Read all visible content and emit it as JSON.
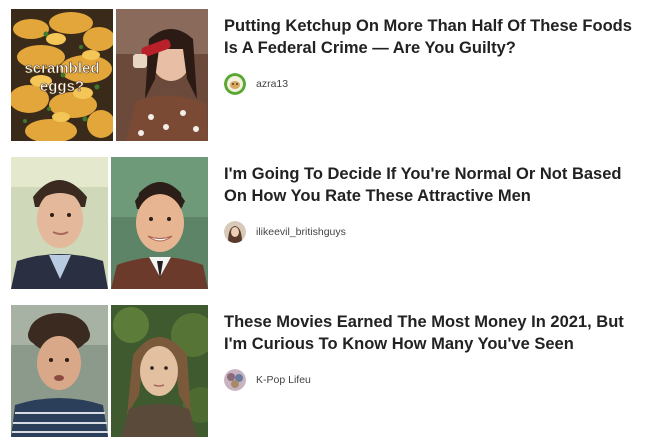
{
  "feed": {
    "items": [
      {
        "title": "Putting Ketchup On More Than Half Of These Foods Is A Federal Crime — Are You Guilty?",
        "image_caption": "scrambled eggs?",
        "author": "azra13"
      },
      {
        "title": "I'm Going To Decide If You're Normal Or Not Based On How You Rate These Attractive Men",
        "image_caption": "",
        "author": "ilikeevil_britishguys"
      },
      {
        "title": "These Movies Earned The Most Money In 2021, But I'm Curious To Know How Many You've Seen",
        "image_caption": "",
        "author": "K-Pop Lifeu"
      }
    ]
  },
  "colors": {
    "title": "#222222",
    "author": "#444444",
    "avatar_ring_green": "#5aa832",
    "caption_text": "#ffffff"
  }
}
